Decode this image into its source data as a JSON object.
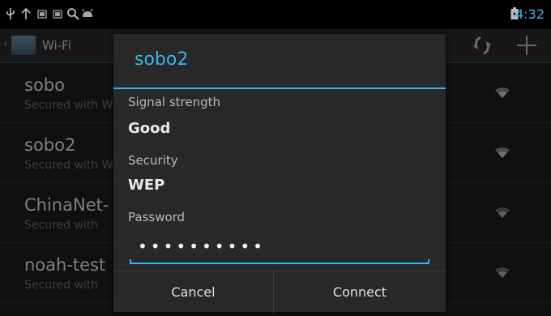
{
  "status_bar": {
    "time": "4:32",
    "icons": [
      "usb-icon",
      "upload-arrow-icon",
      "notification-icon",
      "notification-icon",
      "search-icon",
      "android-icon",
      "battery-icon"
    ]
  },
  "action_bar": {
    "title": "Wi-Fi",
    "actions": [
      "wps-refresh-icon",
      "add-network-icon"
    ]
  },
  "networks": [
    {
      "name": "sobo",
      "subtitle": "Secured with WEP"
    },
    {
      "name": "sobo2",
      "subtitle": "Secured with WEP"
    },
    {
      "name": "ChinaNet-",
      "subtitle": "Secured with"
    },
    {
      "name": "noah-test",
      "subtitle": "Secured with"
    }
  ],
  "dialog": {
    "title": "sobo2",
    "signal_label": "Signal strength",
    "signal_value": "Good",
    "security_label": "Security",
    "security_value": "WEP",
    "password_label": "Password",
    "password_dots": "••••••••••",
    "cancel_label": "Cancel",
    "connect_label": "Connect"
  },
  "colors": {
    "accent": "#33b5e5",
    "dialog_bg": "#282828",
    "background": "#1e1e1e"
  }
}
